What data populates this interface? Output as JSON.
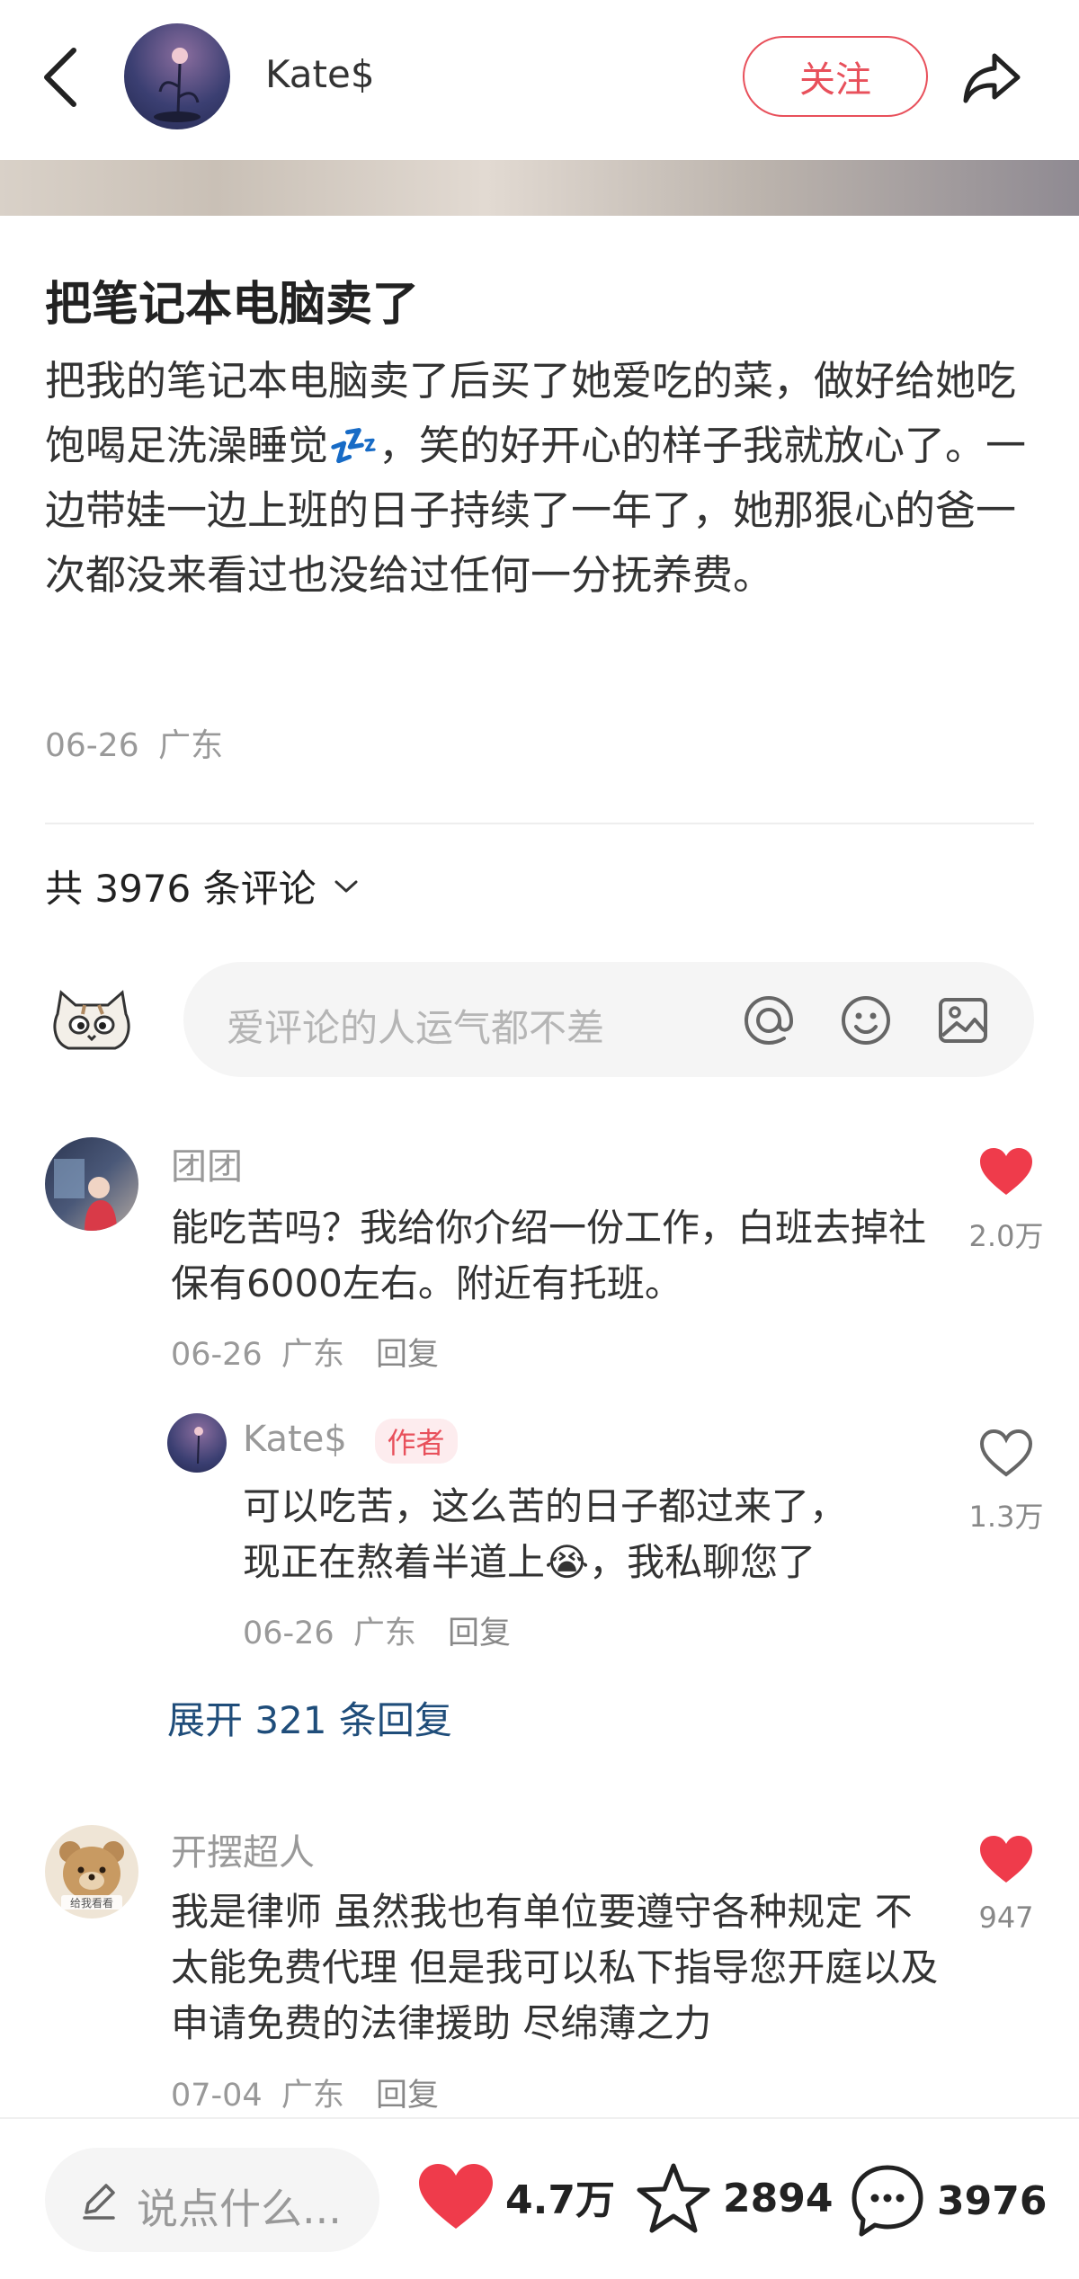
{
  "header": {
    "author_name": "Kate$",
    "follow_label": "关注"
  },
  "post": {
    "title": "把笔记本电脑卖了",
    "body": "把我的笔记本电脑卖了后买了她爱吃的菜，做好给她吃饱喝足洗澡睡觉💤，笑的好开心的样子我就放心了。一边带娃一边上班的日子持续了一年了，她那狠心的爸一次都没来看过也没给过任何一分抚养费。",
    "date": "06-26",
    "location": "广东"
  },
  "comments_header": {
    "label": "共 3976 条评论"
  },
  "comment_input": {
    "placeholder": "爱评论的人运气都不差"
  },
  "comments": [
    {
      "user": "团团",
      "text": "能吃苦吗？我给你介绍一份工作，白班去掉社保有6000左右。附近有托班。",
      "date": "06-26",
      "location": "广东",
      "reply_label": "回复",
      "likes": "2.0万",
      "liked": true,
      "replies": [
        {
          "user": "Kate$",
          "badge": "作者",
          "text_line1": "可以吃苦，这么苦的日子都过来了，",
          "text_line2": "现正在熬着半道上😭，我私聊您了",
          "date": "06-26",
          "location": "广东",
          "reply_label": "回复",
          "likes": "1.3万",
          "liked": false
        }
      ],
      "expand_label": "展开 321 条回复"
    },
    {
      "user": "开摆超人",
      "avatar_caption": "给我看看",
      "text": "我是律师 虽然我也有单位要遵守各种规定 不太能免费代理 但是我可以私下指导您开庭以及申请免费的法律援助 尽绵薄之力",
      "date": "07-04",
      "location": "广东",
      "reply_label": "回复",
      "likes": "947",
      "liked": true
    }
  ],
  "bottom_bar": {
    "say_placeholder": "说点什么...",
    "likes": "4.7万",
    "stars": "2894",
    "comments": "3976"
  },
  "colors": {
    "accent_red": "#e8505b",
    "link_blue": "#1f4d7a"
  }
}
